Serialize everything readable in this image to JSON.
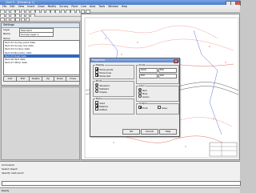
{
  "app": {
    "title": "Civil 3 - [Drawing 1]",
    "title_controls": [
      "minimize",
      "maximize",
      "close"
    ]
  },
  "menubar": [
    "File",
    "Edit",
    "View",
    "Insert",
    "Draw",
    "Modify",
    "Survey",
    "Point",
    "Line",
    "Area",
    "Tools",
    "Window",
    "Help"
  ],
  "left_panel": {
    "header": "Settings",
    "field1_label": "Layer",
    "field1_value": "Standard",
    "field2_label": "Name",
    "field2_value": "Survey Layer 1",
    "list_label": "Items",
    "list_rows": [
      "Item 01 Survey point data",
      "Item 02 Survey line data",
      "Item 03 Contour data",
      "Item 04 Boundary data",
      "Item 05 Road data",
      "Item 06 Text data",
      "Item 07 Other data"
    ],
    "buttons": [
      "Add",
      "Edit",
      "Delete",
      "Up",
      "Down",
      "Close"
    ]
  },
  "dialog": {
    "title": "Properties",
    "group_left_title": "Display",
    "group_left_options": [
      {
        "label": "Show points",
        "checked": true
      },
      {
        "label": "Show lines",
        "checked": false
      },
      {
        "label": "Show text",
        "checked": true
      }
    ],
    "group_left2_title": "Mode",
    "group_left2_options": [
      {
        "label": "Standard",
        "selected": true
      },
      {
        "label": "Detailed",
        "selected": false
      },
      {
        "label": "Simple",
        "selected": false
      }
    ],
    "group_left3_title": "Style",
    "group_left3_options": [
      {
        "label": "Solid",
        "checked": false
      },
      {
        "label": "Dashed",
        "checked": true
      },
      {
        "label": "Dotted",
        "checked": false
      }
    ],
    "group_right_title": "Scale",
    "scale_fields": [
      "1000",
      "500",
      "200",
      "100"
    ],
    "group_right2_title": "Color",
    "color_options": [
      {
        "label": "Red",
        "selected": true
      },
      {
        "label": "Blue",
        "selected": false
      },
      {
        "label": "Green",
        "selected": false
      }
    ],
    "group_right3_title": "Output",
    "output_options": [
      {
        "label": "Print",
        "checked": true
      },
      {
        "label": "Save",
        "checked": false
      }
    ],
    "buttons": [
      "OK",
      "Cancel",
      "Help"
    ]
  },
  "bottom_panel": {
    "lines": [
      "Command:",
      "Select object:",
      "Specify next point:"
    ]
  },
  "statusbar": {
    "text": "Ready"
  },
  "colors": {
    "accent": "#3166c2",
    "drawing_red": "#d84a3a",
    "drawing_blue": "#3a4fd8",
    "drawing_line": "#555555"
  }
}
